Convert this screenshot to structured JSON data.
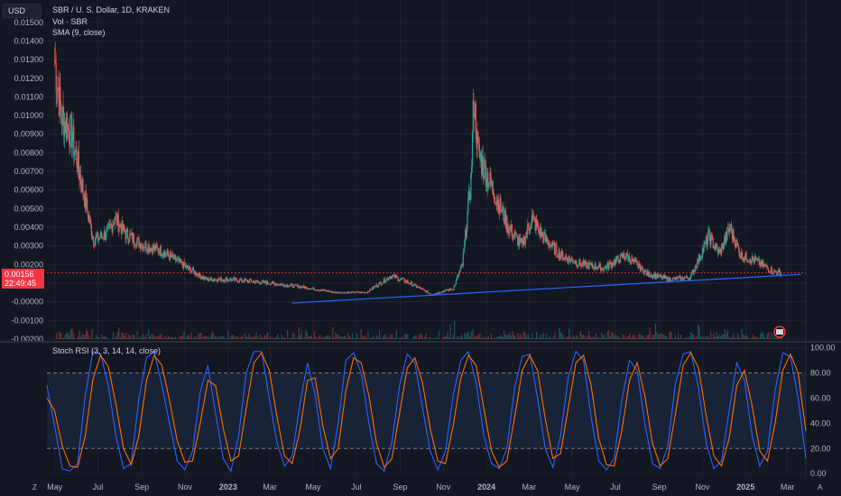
{
  "header": {
    "currency_button": "USD",
    "symbol_title": "SBR / U. S. Dollar, 1D, KRAKEN",
    "volume_legend": "Vol · SBR",
    "sma_legend": "SMA (9, close)",
    "rsi_legend": "Stoch RSI (3, 3, 14, 14, close)"
  },
  "price_tag": {
    "price": "0.00156",
    "countdown": "22:49:45",
    "color": "#f23645"
  },
  "bottom_bar": {
    "left_icon": "Z",
    "right_icon": "A"
  },
  "colors": {
    "background": "#131722",
    "grid": "#1f2430",
    "up": "#26a69a",
    "down": "#ef5350",
    "trendline": "#2962ff",
    "k_line": "#2962ff",
    "d_line": "#ff6d00",
    "rsi_band": "#1e2e4a"
  },
  "chart_data": [
    {
      "type": "candlestick",
      "title": "SBR / U. S. Dollar, 1D, KRAKEN",
      "x_tick_labels": [
        "May",
        "Jul",
        "Sep",
        "Nov",
        "2023",
        "Mar",
        "May",
        "Jul",
        "Sep",
        "Nov",
        "2024",
        "Mar",
        "May",
        "Jul",
        "Sep",
        "Nov",
        "2025",
        "Mar"
      ],
      "y_tick_labels": [
        "0.01500",
        "0.01400",
        "0.01300",
        "0.01200",
        "0.01100",
        "0.01000",
        "0.00900",
        "0.00800",
        "0.00700",
        "0.00600",
        "0.00500",
        "0.00400",
        "0.00300",
        "0.00200",
        "0.00100",
        "-0.00000",
        "-0.00100",
        "-0.00200"
      ],
      "ylim": [
        -0.0021,
        0.0162
      ],
      "current_price": 0.00156,
      "approx_close_series": [
        {
          "date": "2022-05-01",
          "close": 0.013
        },
        {
          "date": "2022-05-10",
          "close": 0.01
        },
        {
          "date": "2022-05-25",
          "close": 0.009
        },
        {
          "date": "2022-06-10",
          "close": 0.006
        },
        {
          "date": "2022-06-25",
          "close": 0.0033
        },
        {
          "date": "2022-07-15",
          "close": 0.0037
        },
        {
          "date": "2022-07-25",
          "close": 0.0045
        },
        {
          "date": "2022-08-10",
          "close": 0.0036
        },
        {
          "date": "2022-09-01",
          "close": 0.0031
        },
        {
          "date": "2022-10-01",
          "close": 0.0027
        },
        {
          "date": "2022-11-01",
          "close": 0.0019
        },
        {
          "date": "2022-12-01",
          "close": 0.0012
        },
        {
          "date": "2023-01-01",
          "close": 0.0012
        },
        {
          "date": "2023-02-01",
          "close": 0.0011
        },
        {
          "date": "2023-03-01",
          "close": 0.001
        },
        {
          "date": "2023-04-15",
          "close": 0.0008
        },
        {
          "date": "2023-06-01",
          "close": 0.0005
        },
        {
          "date": "2023-07-15",
          "close": 0.0005
        },
        {
          "date": "2023-08-20",
          "close": 0.0014
        },
        {
          "date": "2023-09-15",
          "close": 0.001
        },
        {
          "date": "2023-10-15",
          "close": 0.0004
        },
        {
          "date": "2023-11-15",
          "close": 0.0007
        },
        {
          "date": "2023-11-28",
          "close": 0.002
        },
        {
          "date": "2023-12-10",
          "close": 0.0065
        },
        {
          "date": "2023-12-14",
          "close": 0.011
        },
        {
          "date": "2023-12-20",
          "close": 0.008
        },
        {
          "date": "2024-01-10",
          "close": 0.006
        },
        {
          "date": "2024-02-01",
          "close": 0.004
        },
        {
          "date": "2024-02-20",
          "close": 0.003
        },
        {
          "date": "2024-03-05",
          "close": 0.0045
        },
        {
          "date": "2024-03-20",
          "close": 0.0035
        },
        {
          "date": "2024-04-15",
          "close": 0.0025
        },
        {
          "date": "2024-05-15",
          "close": 0.002
        },
        {
          "date": "2024-06-15",
          "close": 0.0018
        },
        {
          "date": "2024-07-15",
          "close": 0.0025
        },
        {
          "date": "2024-08-15",
          "close": 0.0015
        },
        {
          "date": "2024-09-15",
          "close": 0.0012
        },
        {
          "date": "2024-10-15",
          "close": 0.0013
        },
        {
          "date": "2024-11-10",
          "close": 0.0035
        },
        {
          "date": "2024-11-25",
          "close": 0.0026
        },
        {
          "date": "2024-12-10",
          "close": 0.004
        },
        {
          "date": "2024-12-25",
          "close": 0.0025
        },
        {
          "date": "2025-01-15",
          "close": 0.0022
        },
        {
          "date": "2025-02-10",
          "close": 0.0016
        },
        {
          "date": "2025-02-20",
          "close": 0.00156
        }
      ],
      "trendline": {
        "from": {
          "date": "2023-04-01",
          "price": -7e-05
        },
        "to": {
          "date": "2025-03-20",
          "price": 0.00147
        }
      }
    },
    {
      "type": "line",
      "title": "Stoch RSI (3, 3, 14, 14, close)",
      "y_tick_labels": [
        "100.00",
        "80.00",
        "60.00",
        "40.00",
        "20.00",
        "0.00"
      ],
      "ylim": [
        -2,
        104
      ],
      "bands": {
        "upper": 80,
        "lower": 20
      },
      "series": [
        {
          "values": [
            70,
            38,
            4,
            2,
            8,
            62,
            97,
            95,
            70,
            30,
            4,
            8,
            60,
            92,
            97,
            70,
            40,
            10,
            3,
            18,
            65,
            86,
            48,
            12,
            2,
            30,
            80,
            97,
            97,
            60,
            25,
            6,
            14,
            55,
            88,
            62,
            20,
            4,
            40,
            90,
            96,
            80,
            40,
            8,
            2,
            25,
            70,
            95,
            88,
            52,
            18,
            3,
            18,
            62,
            90,
            97,
            72,
            30,
            8,
            4,
            20,
            68,
            93,
            95,
            60,
            20,
            5,
            30,
            76,
            97,
            90,
            45,
            10,
            3,
            12,
            58,
            90,
            82,
            40,
            8,
            4,
            22,
            72,
            95,
            97,
            68,
            24,
            4,
            10,
            50,
            88,
            74,
            30,
            6,
            18,
            66,
            96,
            93,
            60,
            12
          ]
        },
        {
          "values": [
            60,
            50,
            22,
            6,
            5,
            30,
            75,
            94,
            85,
            55,
            20,
            7,
            30,
            74,
            94,
            86,
            58,
            26,
            9,
            10,
            40,
            74,
            70,
            36,
            10,
            14,
            52,
            88,
            96,
            82,
            46,
            14,
            8,
            34,
            74,
            76,
            38,
            12,
            20,
            66,
            92,
            88,
            62,
            24,
            5,
            12,
            48,
            84,
            92,
            72,
            36,
            10,
            8,
            38,
            76,
            94,
            86,
            52,
            18,
            5,
            10,
            44,
            82,
            94,
            82,
            44,
            12,
            16,
            52,
            88,
            94,
            70,
            28,
            7,
            6,
            34,
            74,
            88,
            62,
            24,
            6,
            12,
            48,
            86,
            96,
            84,
            46,
            14,
            6,
            28,
            70,
            82,
            54,
            18,
            10,
            40,
            82,
            95,
            80,
            34
          ]
        }
      ]
    }
  ]
}
